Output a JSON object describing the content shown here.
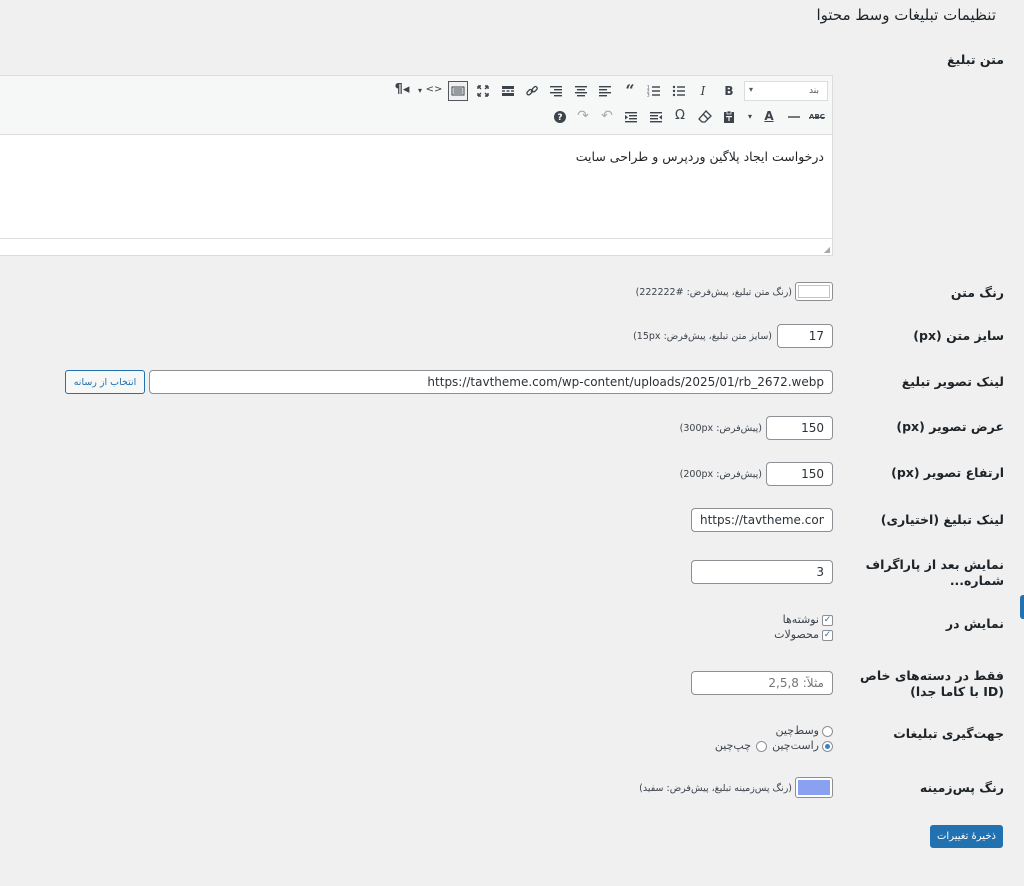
{
  "page": {
    "title": "تنظیمات تبلیغات وسط محتوا"
  },
  "ad_text": {
    "label": "متن تبلیغ",
    "format_value": "بند",
    "content": "درخواست ایجاد پلاگین وردپرس و طراحی سایت",
    "toolbar_row1": [
      "format-select",
      "bold",
      "italic",
      "bullet-list",
      "numbered-list",
      "blockquote",
      "align-left",
      "align-center",
      "align-right",
      "link",
      "read-more",
      "fullscreen",
      "toolbar-toggle",
      "text-mode",
      "paragraph-direction"
    ],
    "toolbar_row2": [
      "strikethrough",
      "horizontal-line",
      "text-color",
      "paste-as-text",
      "clear-formatting",
      "special-character",
      "outdent",
      "indent",
      "undo",
      "redo",
      "help"
    ]
  },
  "text_color": {
    "label": "رنگ متن",
    "description": "(رنگ متن تبلیغ، پیش‌فرض: #222222)",
    "value_color": "#ffffff"
  },
  "font_size": {
    "label": "سایز متن (px)",
    "value": "17",
    "description": "(سایز متن تبلیغ، پیش‌فرض: 15px)"
  },
  "image_link": {
    "label": "لینک تصویر تبلیغ",
    "value": "https://tavtheme.com/wp-content/uploads/2025/01/rb_2672.webp",
    "button": "انتخاب از رسانه"
  },
  "image_width": {
    "label": "عرض تصویر (px)",
    "value": "150",
    "description": "(پیش‌فرض: 300px)"
  },
  "image_height": {
    "label": "ارتفاع تصویر (px)",
    "value": "150",
    "description": "(پیش‌فرض: 200px)"
  },
  "ad_link": {
    "label": "لینک تبلیغ (اختیاری)",
    "value": "https://tavtheme.com/info/"
  },
  "after_paragraph": {
    "label": "نمایش بعد از پاراگراف شماره...",
    "value": "3"
  },
  "display_in": {
    "label": "نمایش در",
    "options": [
      {
        "label": "نوشته‌ها",
        "checked": true
      },
      {
        "label": "محصولات",
        "checked": true
      }
    ]
  },
  "categories": {
    "label": "فقط در دسته‌های خاص (ID با کاما جدا)",
    "placeholder": "مثلاً: 2,5,8"
  },
  "alignment": {
    "label": "جهت‌گیری تبلیغات",
    "options": [
      {
        "label": "وسط‌چین",
        "checked": false
      },
      {
        "label": "راست‌چین",
        "checked": true
      },
      {
        "label": "چپ‌چین",
        "checked": false
      }
    ]
  },
  "bg_color": {
    "label": "رنگ پس‌زمینه",
    "description": "(رنگ پس‌زمینه تبلیغ، پیش‌فرض: سفید)",
    "value_color": "#8aa0f0"
  },
  "save": {
    "label": "ذخیرهٔ تغییرات"
  },
  "colors": {
    "accent": "#2271b1",
    "background": "#f0f0f1"
  }
}
